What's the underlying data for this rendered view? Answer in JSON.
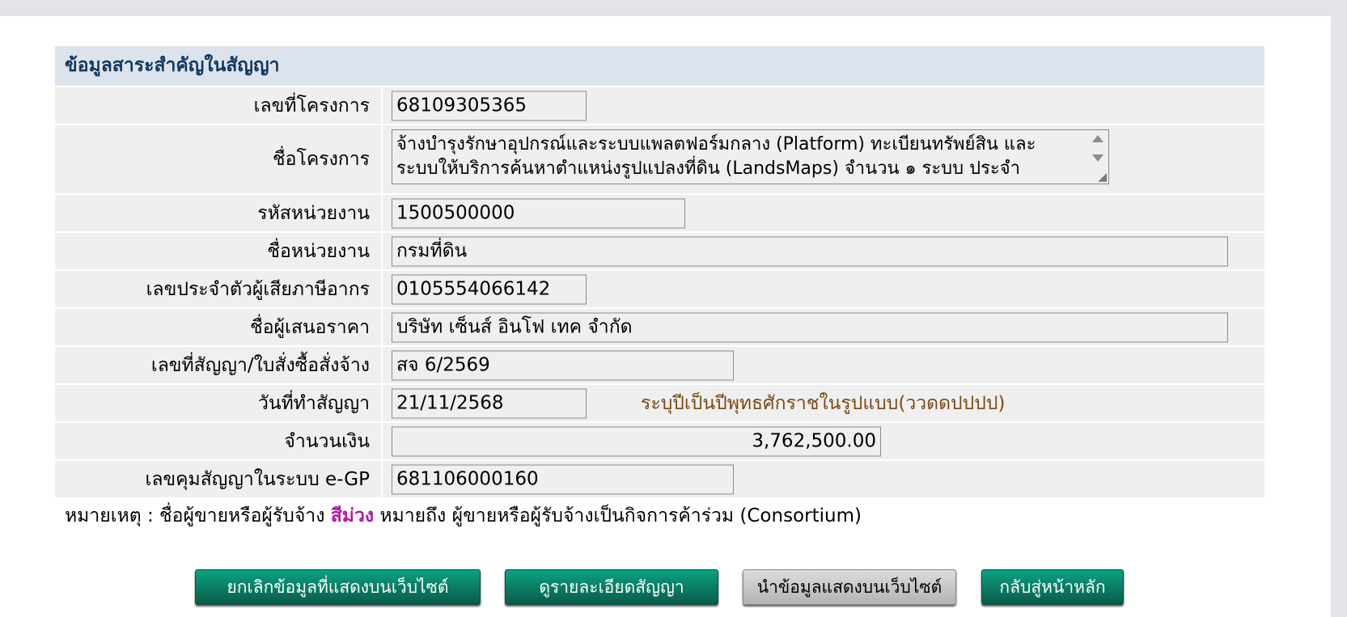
{
  "header": {
    "title": "ข้อมูลสาระสำคัญในสัญญา"
  },
  "fields": {
    "project_no": {
      "label": "เลขที่โครงการ",
      "value": "68109305365"
    },
    "project_name": {
      "label": "ชื่อโครงการ",
      "value": "จ้างบำรุงรักษาอุปกรณ์และระบบแพลตฟอร์มกลาง (Platform) ทะเบียนทรัพย์สิน และระบบให้บริการค้นหาตำแหน่งรูปแปลงที่ดิน (LandsMaps) จำนวน ๑ ระบบ ประจำ"
    },
    "dept_code": {
      "label": "รหัสหน่วยงาน",
      "value": "1500500000"
    },
    "dept_name": {
      "label": "ชื่อหน่วยงาน",
      "value": "กรมที่ดิน"
    },
    "tax_id": {
      "label": "เลขประจำตัวผู้เสียภาษีอากร",
      "value": "0105554066142"
    },
    "bidder_name": {
      "label": "ชื่อผู้เสนอราคา",
      "value": "บริษัท เซ็นส์ อินโฟ เทค  จำกัด"
    },
    "contract_no": {
      "label": "เลขที่สัญญา/ใบสั่งซื้อสั่งจ้าง",
      "value": "สจ 6/2569"
    },
    "contract_date": {
      "label": "วันที่ทำสัญญา",
      "value": "21/11/2568",
      "hint": "ระบุปีเป็นปีพุทธศักราชในรูปแบบ(ววดดปปปป)"
    },
    "amount": {
      "label": "จำนวนเงิน",
      "value": "3,762,500.00"
    },
    "egp_no": {
      "label": "เลขคุมสัญญาในระบบ e-GP",
      "value": "681106000160"
    }
  },
  "note": {
    "prefix": "หมายเหตุ : ชื่อผู้ขายหรือผู้รับจ้าง ",
    "highlight": "สีม่วง",
    "suffix": " หมายถึง ผู้ขายหรือผู้รับจ้างเป็นกิจการค้าร่วม (Consortium)"
  },
  "buttons": {
    "cancel": "ยกเลิกข้อมูลที่แสดงบนเว็บไซต์",
    "details": "ดูรายละเอียดสัญญา",
    "publish": "นำข้อมูลแสดงบนเว็บไซต์",
    "home": "กลับสู่หน้าหลัก"
  },
  "colors": {
    "header_bg": "#dde3ec",
    "header_text": "#12385f",
    "row_bg": "#efefef",
    "button_green": "#0b7a62",
    "button_gray": "#c6c6c6",
    "note_purple": "#b01aa8",
    "hint_brown": "#7a4a12"
  }
}
